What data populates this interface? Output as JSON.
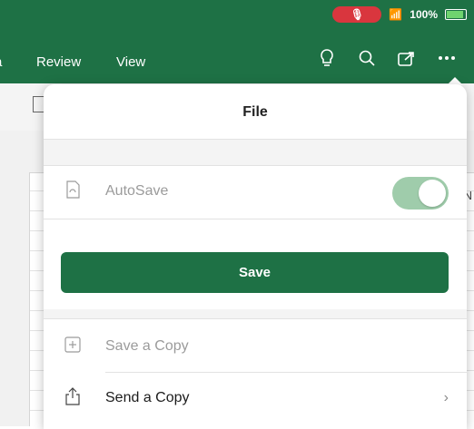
{
  "status_bar": {
    "battery": "100%",
    "mic_color": "#d9363e"
  },
  "ribbon": {
    "tabs": [
      {
        "label": "a"
      },
      {
        "label": "Review"
      },
      {
        "label": "View"
      }
    ],
    "icons": [
      "lightbulb-icon",
      "search-icon",
      "share-icon",
      "more-icon"
    ]
  },
  "sheet": {
    "visible_column_letter": "N"
  },
  "file_menu": {
    "title": "File",
    "autosave_label": "AutoSave",
    "autosave_on": true,
    "save_label": "Save",
    "save_copy_label": "Save a Copy",
    "send_copy_label": "Send a Copy"
  },
  "colors": {
    "accent": "#1e7145",
    "toggle_on": "#9fccab"
  }
}
